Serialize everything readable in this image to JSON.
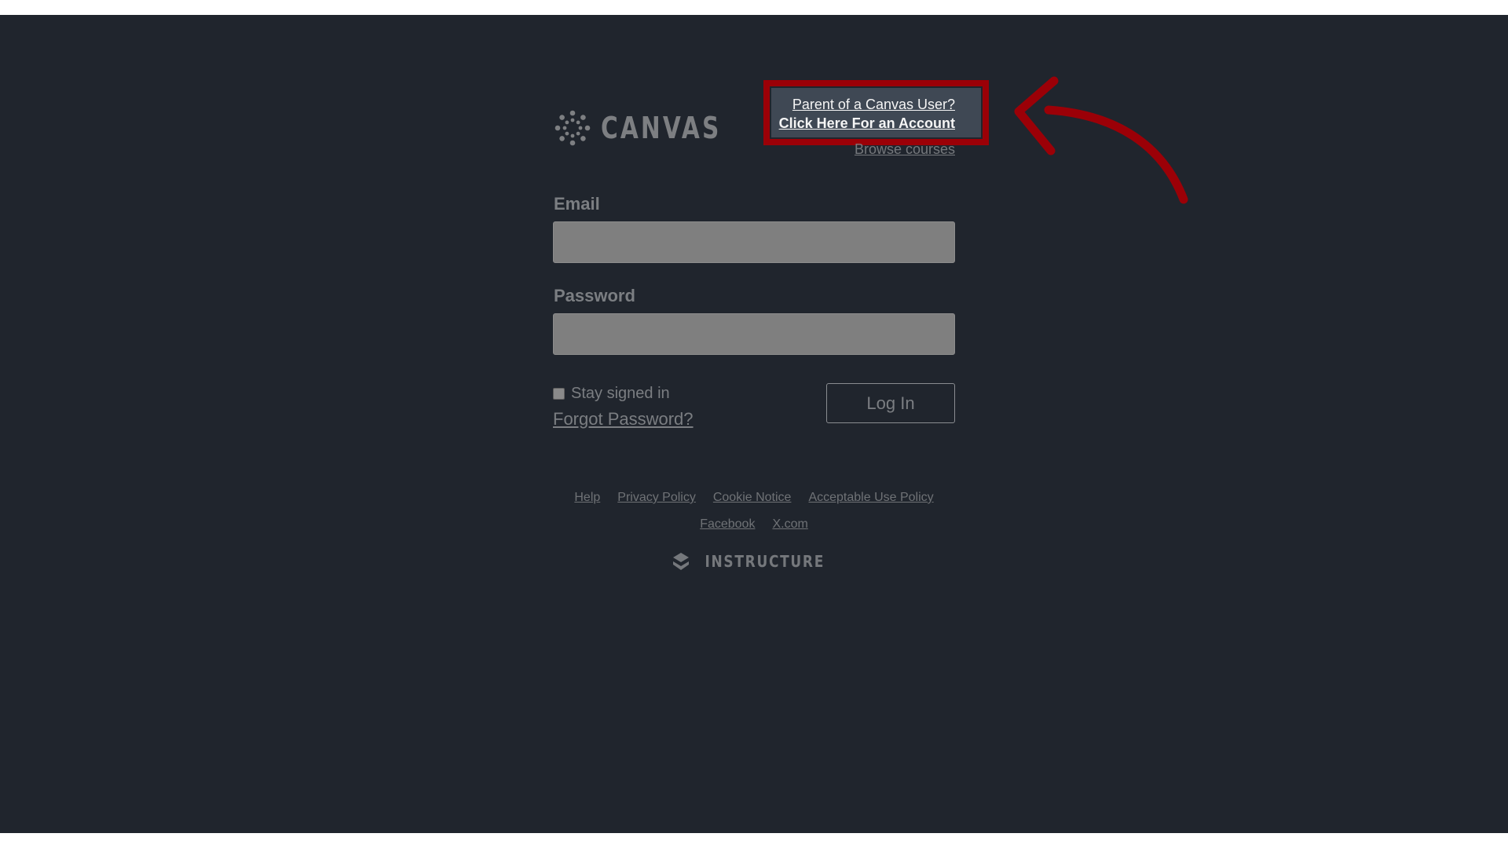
{
  "brand": {
    "logo_text": "CANVAS",
    "footer_logo_text": "INSTRUCTURE"
  },
  "header": {
    "parent_line1": "Parent of a Canvas User?",
    "parent_line2": "Click Here For an Account",
    "browse_courses": "Browse courses"
  },
  "form": {
    "email_label": "Email",
    "email_value": "",
    "password_label": "Password",
    "password_value": "",
    "stay_signed_in_label": "Stay signed in",
    "stay_signed_in_checked": false,
    "forgot_password": "Forgot Password?",
    "login_button": "Log In"
  },
  "footer": {
    "links_row1": [
      "Help",
      "Privacy Policy",
      "Cookie Notice",
      "Acceptable Use Policy"
    ],
    "links_row2": [
      "Facebook",
      "X.com"
    ]
  },
  "annotation": {
    "highlight_color": "#9b0007",
    "arrow_icon": "curved-arrow-icon"
  },
  "colors": {
    "background": "#20252d",
    "field_fill": "#7f7f7f",
    "callout_fill": "#3f4854"
  }
}
